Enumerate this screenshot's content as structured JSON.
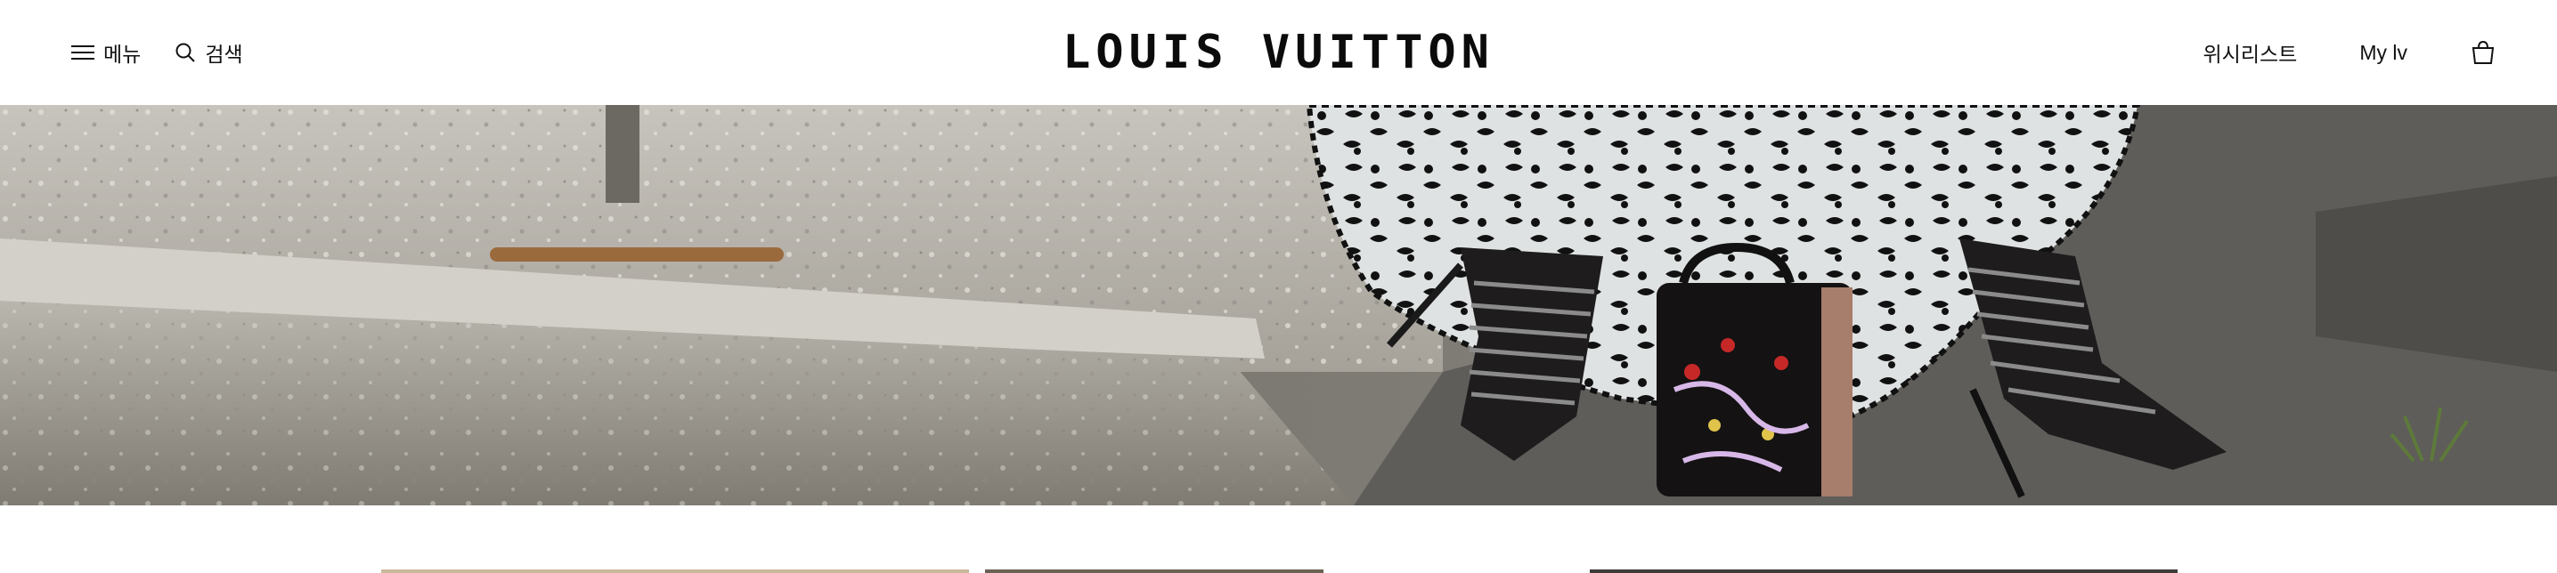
{
  "header": {
    "menu_label": "메뉴",
    "search_label": "검색",
    "logo_text": "LOUIS VUITTON",
    "wishlist_label": "위시리스트",
    "account_label": "My lv",
    "cart_count": ""
  },
  "hero": {
    "image": "fashion-photo: lace dress, strappy black heels, embroidered black handbag on concrete step"
  },
  "colors": {
    "header_bg": "#ffffff",
    "text": "#111111"
  },
  "icons": {
    "menu": "hamburger-icon",
    "search": "search-icon",
    "cart": "shopping-bag-icon"
  }
}
